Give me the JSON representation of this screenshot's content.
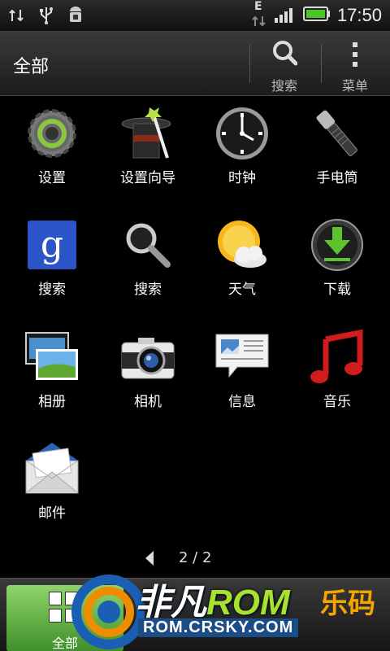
{
  "status_bar": {
    "time": "17:50",
    "network_letter": "E",
    "icons": [
      "data-sync-icon",
      "usb-icon",
      "android-debug-icon",
      "signal-icon",
      "battery-icon"
    ]
  },
  "action_bar": {
    "title": "全部",
    "search_label": "搜索",
    "menu_label": "菜单"
  },
  "apps": [
    {
      "label": "设置",
      "icon": "settings-gear-icon"
    },
    {
      "label": "设置向导",
      "icon": "setup-wizard-hat-icon"
    },
    {
      "label": "时钟",
      "icon": "clock-icon"
    },
    {
      "label": "手电筒",
      "icon": "flashlight-icon"
    },
    {
      "label": "搜索",
      "icon": "google-search-icon"
    },
    {
      "label": "搜索",
      "icon": "magnifier-search-icon"
    },
    {
      "label": "天气",
      "icon": "weather-icon"
    },
    {
      "label": "下载",
      "icon": "download-icon"
    },
    {
      "label": "相册",
      "icon": "gallery-icon"
    },
    {
      "label": "相机",
      "icon": "camera-icon"
    },
    {
      "label": "信息",
      "icon": "messages-icon"
    },
    {
      "label": "音乐",
      "icon": "music-icon"
    },
    {
      "label": "邮件",
      "icon": "mail-icon"
    }
  ],
  "pager": {
    "text": "2 / 2"
  },
  "bottom_bar": {
    "tab_all": "全部"
  },
  "watermark": {
    "brand_a": "非凡",
    "brand_b": "ROM",
    "url": "ROM.CRSKY.COM",
    "cn": "乐码"
  }
}
